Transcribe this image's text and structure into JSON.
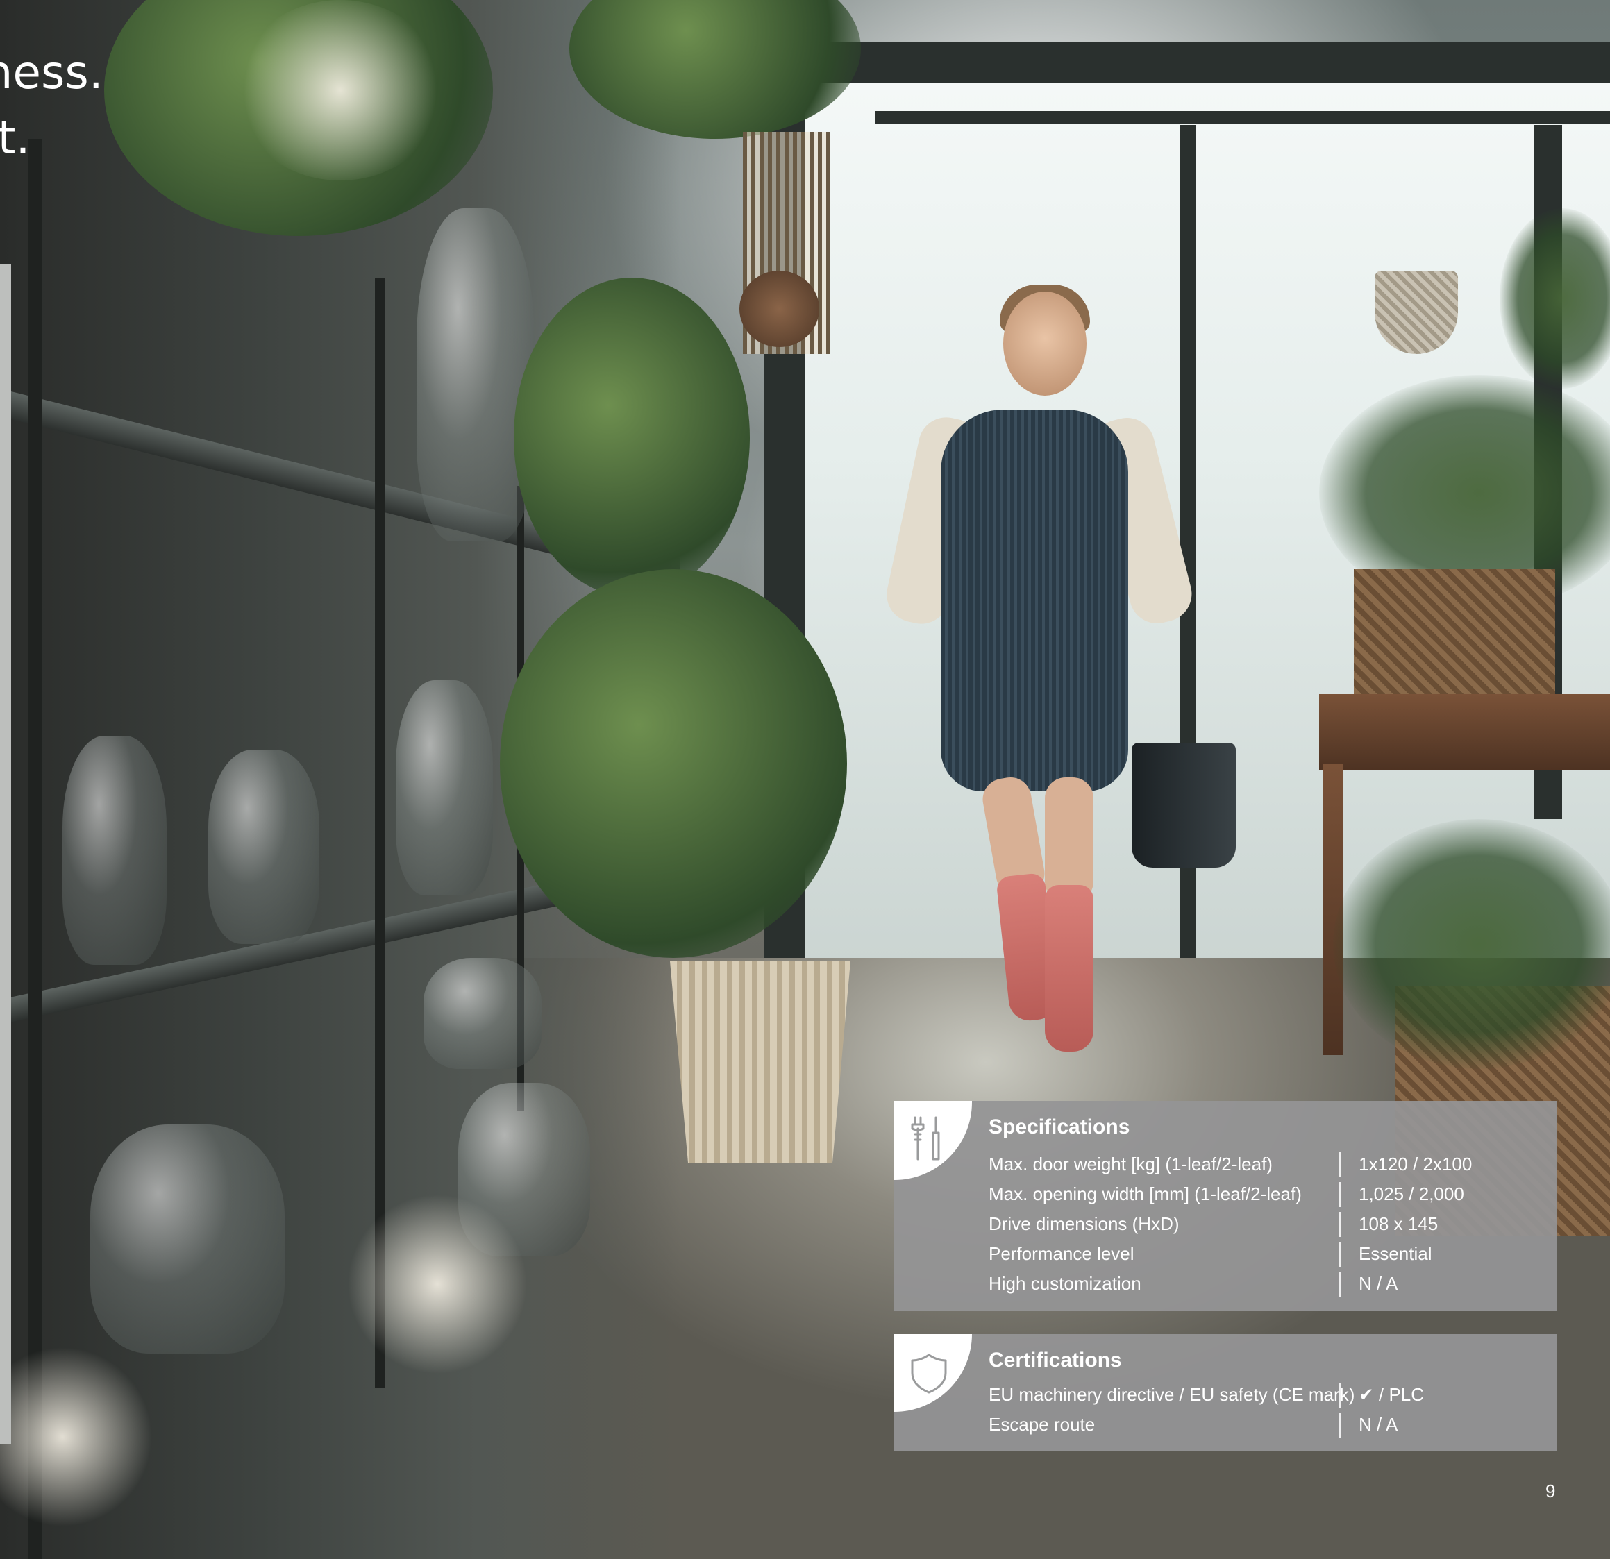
{
  "heading": {
    "line1": "usiness.",
    "line2": "et."
  },
  "specifications": {
    "icon": "tools-icon",
    "title": "Specifications",
    "rows": [
      {
        "label": "Max. door weight [kg] (1-leaf/2-leaf)",
        "value": "1x120 / 2x100"
      },
      {
        "label": "Max. opening width [mm] (1-leaf/2-leaf)",
        "value": "1,025 / 2,000"
      },
      {
        "label": "Drive dimensions (HxD)",
        "value": "108 x 145"
      },
      {
        "label": "Performance level",
        "value": "Essential"
      },
      {
        "label": "High customization",
        "value": "N / A"
      }
    ]
  },
  "certifications": {
    "icon": "shield-icon",
    "title": "Certifications",
    "rows": [
      {
        "label": "EU machinery directive / EU safety (CE mark)",
        "value": "✔ / PLC"
      },
      {
        "label": "Escape route",
        "value": "N / A"
      }
    ]
  },
  "page_number": "9",
  "colors": {
    "panel_background": "#949596",
    "text": "#ffffff"
  }
}
